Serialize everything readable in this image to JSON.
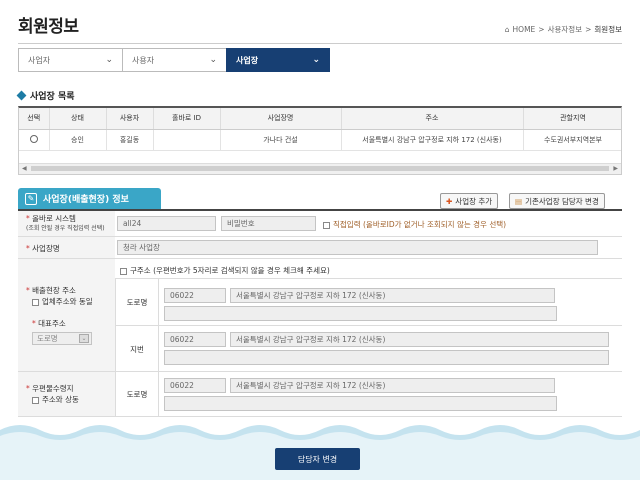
{
  "page": {
    "title": "회원정보"
  },
  "breadcrumb": {
    "home": "HOME",
    "sep": ">",
    "level1": "사용자정보",
    "current": "회원정보"
  },
  "selects": [
    {
      "label": "사업자"
    },
    {
      "label": "사용자"
    },
    {
      "label": "사업장"
    }
  ],
  "list": {
    "title": "사업장 목록",
    "columns": [
      "선택",
      "상태",
      "사용자",
      "홀바로 ID",
      "사업장명",
      "주소",
      "관할지역"
    ],
    "rows": [
      {
        "status": "승인",
        "user": "홍길동",
        "hid": "",
        "name": "가나다 건설",
        "address": "서울특별시 강남구 압구정로 지하 172 (신사동)",
        "region": "수도권서부지역본부"
      }
    ]
  },
  "detail": {
    "tab_label": "사업장(배출현장) 정보",
    "add_button": "사업장 추가",
    "manager_button": "기존사업장 담당자 변경",
    "system_label": "올바로 시스템",
    "system_hint": "(조회 안될 경우 직접입력 선택)",
    "id_value": "all24",
    "password_placeholder": "비밀번호",
    "direct_input_label": "직접입력",
    "direct_input_hint": "(올바로ID가 없거나 조회되지 않는 경우 선택)",
    "site_name_label": "사업장명",
    "site_name_value": "청라 사업장",
    "old_address_note": "구주소 (우편번호가 5자리로 검색되지 않을 경우 체크해 주세요)",
    "discharge_address_label": "배출현장 주소",
    "same_as_company_label": "업체주소와 동일",
    "rep_address_label": "대표주소",
    "rep_address_select": "도로명",
    "road_label": "도로명",
    "jibun_label": "지번",
    "zip": "06022",
    "address": "서울특별시 강남구 압구정로 지하 172 (신사동)",
    "mail_address_label": "우편물수령지",
    "same_as_address_label": "주소와 상동",
    "mail_road_label": "도로명"
  },
  "footer": {
    "submit_label": "담당자 변경"
  },
  "colors": {
    "navy": "#173f73",
    "teal": "#3aa6c7",
    "wave": "#c5e3ef"
  }
}
